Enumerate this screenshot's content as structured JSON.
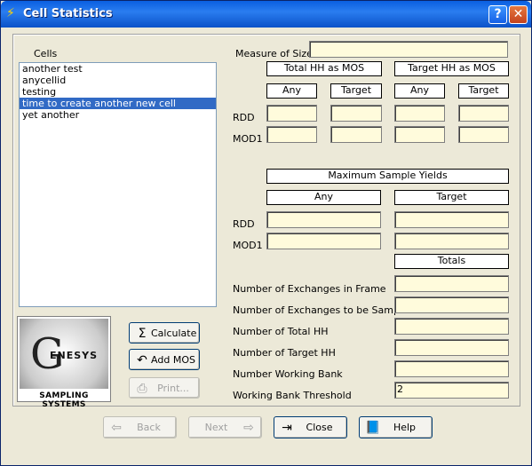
{
  "window": {
    "title": "Cell Statistics",
    "help_glyph": "?",
    "close_glyph": "✕"
  },
  "cells": {
    "label": "Cells",
    "items": [
      "another test",
      "anycellid",
      "testing",
      "time to create another new cell",
      "yet another"
    ],
    "selected_index": 3
  },
  "mos": {
    "label": "Measure of Size",
    "value": "",
    "col_total": "Total HH as MOS",
    "col_target": "Target HH as MOS",
    "sub_any": "Any",
    "sub_target": "Target",
    "row_rdd": "RDD",
    "row_mod1": "MOD1"
  },
  "yields": {
    "header": "Maximum Sample Yields",
    "col_any": "Any",
    "col_target": "Target",
    "row_rdd": "RDD",
    "row_mod1": "MOD1"
  },
  "totals": {
    "header": "Totals",
    "rows": [
      {
        "label": "Number of Exchanges in Frame",
        "value": ""
      },
      {
        "label": "Number of Exchanges to be Sampled",
        "value": ""
      },
      {
        "label": "Number of Total HH",
        "value": ""
      },
      {
        "label": "Number of Target HH",
        "value": ""
      },
      {
        "label": "Number Working Bank",
        "value": ""
      },
      {
        "label": "Working  Bank Threshold",
        "value": "2"
      }
    ]
  },
  "logo": {
    "initial": "G",
    "word": "ENESYS",
    "subtitle": "SAMPLING SYSTEMS"
  },
  "buttons": {
    "calculate": "Calculate",
    "add_mos": "Add MOS",
    "print": "Print...",
    "back": "Back",
    "next": "Next",
    "close": "Close",
    "help": "Help"
  }
}
